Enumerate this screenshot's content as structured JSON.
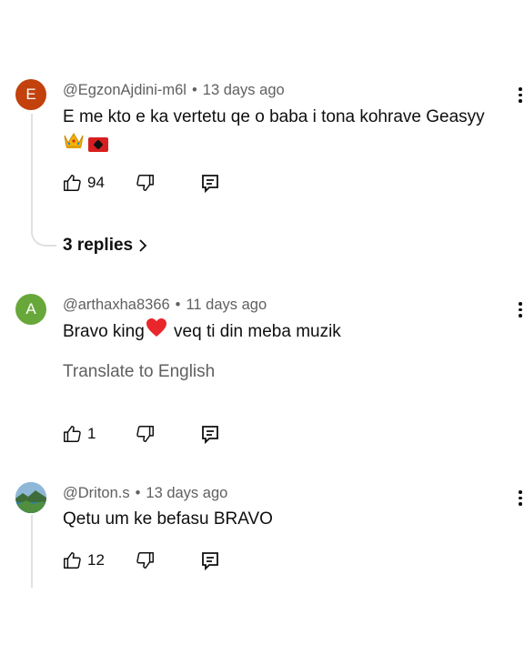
{
  "comments": [
    {
      "avatar_letter": "E",
      "avatar_color": "#c2410c",
      "author": "@EgzonAjdini-m6l",
      "age": "13 days ago",
      "text_line1": "E me kto e ka vertetu qe o baba i tona kohrave Geasyy",
      "emoji": [
        "crown-emoji",
        "albania-flag-emoji"
      ],
      "likes": "94",
      "replies_label": "3 replies"
    },
    {
      "avatar_letter": "A",
      "avatar_color": "#68a83a",
      "author": "@arthaxha8366",
      "age": "11 days ago",
      "text_before": "Bravo king",
      "text_after": " veq ti din meba muzik",
      "emoji": [
        "red-heart-emoji"
      ],
      "translate_label": "Translate to English",
      "likes": "1"
    },
    {
      "avatar_color": "#4a7aa0",
      "author": "@Driton.s",
      "age": "13 days ago",
      "text": "Qetu um ke befasu BRAVO",
      "likes": "12"
    }
  ],
  "separator": "•"
}
